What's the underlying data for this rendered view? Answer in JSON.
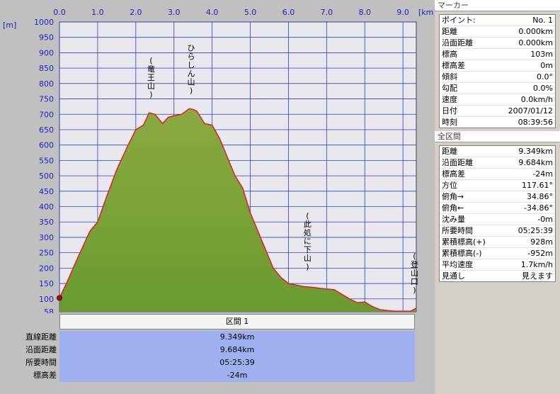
{
  "chart_data": {
    "type": "area",
    "x_unit": "[km]",
    "y_unit": "[m]",
    "xlim": [
      0,
      9.349
    ],
    "ylim": [
      58,
      1000
    ],
    "x_ticks": [
      "0.0",
      "1.0",
      "2.0",
      "3.0",
      "4.0",
      "5.0",
      "6.0",
      "7.0",
      "8.0",
      "9.0"
    ],
    "y_ticks": [
      "1000",
      "950",
      "900",
      "850",
      "800",
      "750",
      "700",
      "650",
      "600",
      "550",
      "500",
      "450",
      "400",
      "350",
      "300",
      "250",
      "200",
      "150",
      "100",
      "58"
    ],
    "grid": true,
    "fill_color": "#6a9a30",
    "line_color": "#e02020",
    "series": [
      {
        "x": [
          0,
          0.2,
          0.5,
          0.8,
          1.0,
          1.2,
          1.5,
          1.8,
          2.0,
          2.2,
          2.35,
          2.5,
          2.7,
          2.85,
          3.0,
          3.2,
          3.4,
          3.5,
          3.6,
          3.8,
          4.0,
          4.2,
          4.4,
          4.6,
          4.8,
          5.0,
          5.2,
          5.4,
          5.6,
          5.8,
          6.0,
          6.2,
          6.4,
          6.6,
          6.8,
          7.0,
          7.2,
          7.4,
          7.6,
          7.8,
          8.0,
          8.2,
          8.4,
          8.6,
          8.8,
          9.0,
          9.2,
          9.349
        ],
        "y": [
          103,
          155,
          240,
          320,
          350,
          420,
          520,
          600,
          650,
          665,
          705,
          700,
          670,
          690,
          695,
          700,
          718,
          716,
          710,
          670,
          665,
          620,
          560,
          500,
          460,
          380,
          320,
          260,
          200,
          170,
          150,
          145,
          140,
          138,
          135,
          132,
          130,
          115,
          100,
          88,
          90,
          75,
          65,
          62,
          60,
          60,
          60,
          70
        ]
      }
    ],
    "annotations": [
      {
        "text": "(竜王山)",
        "x": 2.4,
        "y": 705
      },
      {
        "text": "ひらしん山)",
        "x": 3.45,
        "y": 718
      },
      {
        "text": "(此処に下山)",
        "x": 6.5,
        "y": 145
      },
      {
        "text": "(登山口)",
        "x": 9.3,
        "y": 70
      }
    ]
  },
  "section": {
    "title": "区間 1",
    "rows": [
      {
        "label": "直線距離",
        "value": "9.349km"
      },
      {
        "label": "沿面距離",
        "value": "9.684km"
      },
      {
        "label": "所要時間",
        "value": "05:25:39"
      },
      {
        "label": "標高差",
        "value": "-24m"
      }
    ]
  },
  "marker": {
    "title": "マーカー",
    "rows": [
      {
        "k": "ポイント:",
        "v": "No. 1"
      },
      {
        "k": "距離",
        "v": "0.000km"
      },
      {
        "k": "沿面距離",
        "v": "0.000km"
      },
      {
        "k": "標高",
        "v": "103m"
      },
      {
        "k": "標高差",
        "v": "0m"
      },
      {
        "k": "傾斜",
        "v": "0.0°"
      },
      {
        "k": "勾配",
        "v": "0.0%"
      },
      {
        "k": "速度",
        "v": "0.0km/h"
      },
      {
        "k": "日付",
        "v": "2007/01/12"
      },
      {
        "k": "時刻",
        "v": "08:39:56"
      }
    ]
  },
  "whole": {
    "title": "全区間",
    "rows": [
      {
        "k": "距離",
        "v": "9.349km"
      },
      {
        "k": "沿面距離",
        "v": "9.684km"
      },
      {
        "k": "標高差",
        "v": "-24m"
      },
      {
        "k": "方位",
        "v": "117.61°"
      },
      {
        "k": "俯角→",
        "v": "34.86°"
      },
      {
        "k": "俯角←",
        "v": "-34.86°"
      },
      {
        "k": "沈み量",
        "v": "-0m"
      },
      {
        "k": "所要時間",
        "v": "05:25:39"
      },
      {
        "k": "累積標高(+)",
        "v": "928m"
      },
      {
        "k": "累積標高(-)",
        "v": "-952m"
      },
      {
        "k": "平均速度",
        "v": "1.7km/h"
      },
      {
        "k": "見通し",
        "v": "見えます"
      }
    ]
  }
}
